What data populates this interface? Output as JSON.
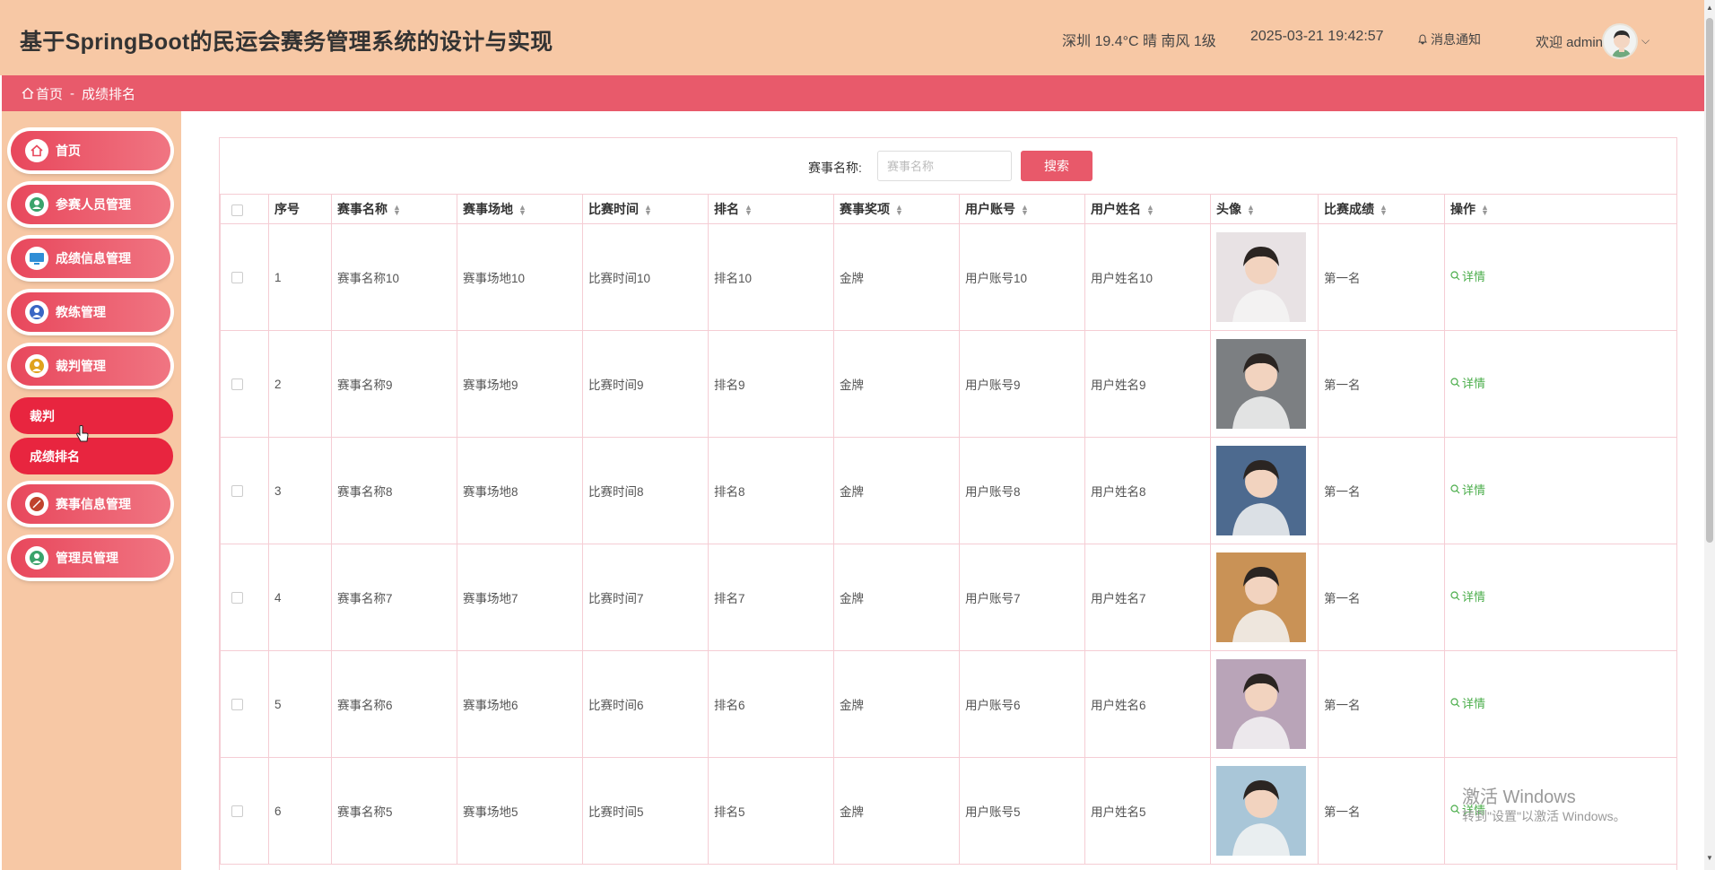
{
  "header": {
    "title": "基于SpringBoot的民运会赛务管理系统的设计与实现",
    "weather": "深圳 19.4°C 晴 南风 1级",
    "datetime": "2025-03-21 19:42:57",
    "notify_label": "消息通知",
    "welcome": "欢迎 admin"
  },
  "breadcrumb": {
    "home": "首页",
    "separator": "-",
    "current": "成绩排名"
  },
  "sidebar": {
    "items": [
      {
        "label": "首页",
        "icon": "home-icon",
        "color": "#e8475c"
      },
      {
        "label": "参赛人员管理",
        "icon": "athlete-icon",
        "color": "#3aa36b"
      },
      {
        "label": "成绩信息管理",
        "icon": "monitor-icon",
        "color": "#2f8ed6"
      },
      {
        "label": "教练管理",
        "icon": "person-icon",
        "color": "#3a66c4"
      },
      {
        "label": "裁判管理",
        "icon": "referee-icon",
        "color": "#e0a21c"
      },
      {
        "label": "赛事信息管理",
        "icon": "ball-icon",
        "color": "#c0432d"
      },
      {
        "label": "管理员管理",
        "icon": "admin-icon",
        "color": "#3aa36b"
      }
    ],
    "submenu": [
      {
        "label": "裁判"
      },
      {
        "label": "成绩排名"
      }
    ]
  },
  "search": {
    "label": "赛事名称:",
    "placeholder": "赛事名称",
    "button": "搜索"
  },
  "table": {
    "columns": [
      "序号",
      "赛事名称",
      "赛事场地",
      "比赛时间",
      "排名",
      "赛事奖项",
      "用户账号",
      "用户姓名",
      "头像",
      "比赛成绩",
      "操作"
    ],
    "detail_label": "详情",
    "rows": [
      {
        "no": "1",
        "event": "赛事名称10",
        "venue": "赛事场地10",
        "time": "比赛时间10",
        "rank": "排名10",
        "award": "金牌",
        "account": "用户账号10",
        "name": "用户姓名10",
        "score": "第一名",
        "avatar_color": "#e8e2e4"
      },
      {
        "no": "2",
        "event": "赛事名称9",
        "venue": "赛事场地9",
        "time": "比赛时间9",
        "rank": "排名9",
        "award": "金牌",
        "account": "用户账号9",
        "name": "用户姓名9",
        "score": "第一名",
        "avatar_color": "#7c7f82"
      },
      {
        "no": "3",
        "event": "赛事名称8",
        "venue": "赛事场地8",
        "time": "比赛时间8",
        "rank": "排名8",
        "award": "金牌",
        "account": "用户账号8",
        "name": "用户姓名8",
        "score": "第一名",
        "avatar_color": "#4d6a8f"
      },
      {
        "no": "4",
        "event": "赛事名称7",
        "venue": "赛事场地7",
        "time": "比赛时间7",
        "rank": "排名7",
        "award": "金牌",
        "account": "用户账号7",
        "name": "用户姓名7",
        "score": "第一名",
        "avatar_color": "#c99256"
      },
      {
        "no": "5",
        "event": "赛事名称6",
        "venue": "赛事场地6",
        "time": "比赛时间6",
        "rank": "排名6",
        "award": "金牌",
        "account": "用户账号6",
        "name": "用户姓名6",
        "score": "第一名",
        "avatar_color": "#b9a4b8"
      },
      {
        "no": "6",
        "event": "赛事名称5",
        "venue": "赛事场地5",
        "time": "比赛时间5",
        "rank": "排名5",
        "award": "金牌",
        "account": "用户账号5",
        "name": "用户姓名5",
        "score": "第一名",
        "avatar_color": "#a9c6d8"
      }
    ]
  },
  "watermark": {
    "line1": "激活 Windows",
    "line2": "转到\"设置\"以激活 Windows。"
  }
}
